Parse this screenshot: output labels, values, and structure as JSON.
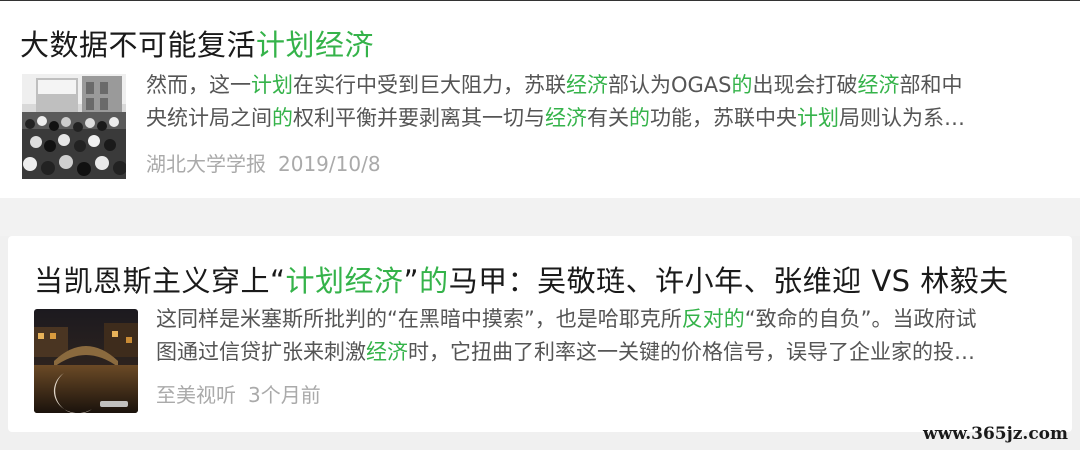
{
  "articles": [
    {
      "title_segments": [
        {
          "text": "大数据不可能复活",
          "hl": false
        },
        {
          "text": "计划经济",
          "hl": true
        }
      ],
      "thumbnail": "old-crowd-street-photo",
      "desc_lines": [
        [
          {
            "text": "然而，这一",
            "hl": false
          },
          {
            "text": "计划",
            "hl": true
          },
          {
            "text": "在实行中受到巨大阻力，苏联",
            "hl": false
          },
          {
            "text": "经济",
            "hl": true
          },
          {
            "text": "部认为OGAS",
            "hl": false
          },
          {
            "text": "的",
            "hl": true
          },
          {
            "text": "出现会打破",
            "hl": false
          },
          {
            "text": "经济",
            "hl": true
          },
          {
            "text": "部和中",
            "hl": false
          }
        ],
        [
          {
            "text": "央统计局之间",
            "hl": false
          },
          {
            "text": "的",
            "hl": true
          },
          {
            "text": "权利平衡并要剥离其一切与",
            "hl": false
          },
          {
            "text": "经济",
            "hl": true
          },
          {
            "text": "有关",
            "hl": false
          },
          {
            "text": "的",
            "hl": true
          },
          {
            "text": "功能，苏联中央",
            "hl": false
          },
          {
            "text": "计划",
            "hl": true
          },
          {
            "text": "局则认为系…",
            "hl": false
          }
        ]
      ],
      "source": "湖北大学学报",
      "date": "2019/10/8"
    },
    {
      "title_segments": [
        {
          "text": "当凯恩斯主义穿上“",
          "hl": false
        },
        {
          "text": "计划经济",
          "hl": true
        },
        {
          "text": "”",
          "hl": false
        },
        {
          "text": "的",
          "hl": true
        },
        {
          "text": "马甲：吴敬琏、许小年、张维迎 VS 林毅夫",
          "hl": false
        }
      ],
      "thumbnail": "night-canal-bridge-photo",
      "desc_lines": [
        [
          {
            "text": "这同样是米塞斯所批判的“在黑暗中摸索”，也是哈耶克所",
            "hl": false
          },
          {
            "text": "反对的",
            "hl": true
          },
          {
            "text": "“致命的自负”。当政府试",
            "hl": false
          }
        ],
        [
          {
            "text": "图通过信贷扩张来刺激",
            "hl": false
          },
          {
            "text": "经济",
            "hl": true
          },
          {
            "text": "时，它扭曲了利率这一关键的价格信号，误导了企业家的投…",
            "hl": false
          }
        ]
      ],
      "source": "至美视听",
      "date": "3个月前"
    }
  ],
  "watermark": "www.365jz.com",
  "colors": {
    "highlight": "#35b34a",
    "title": "#1a1a1a",
    "body": "#555555",
    "meta": "#aaaaaa"
  }
}
